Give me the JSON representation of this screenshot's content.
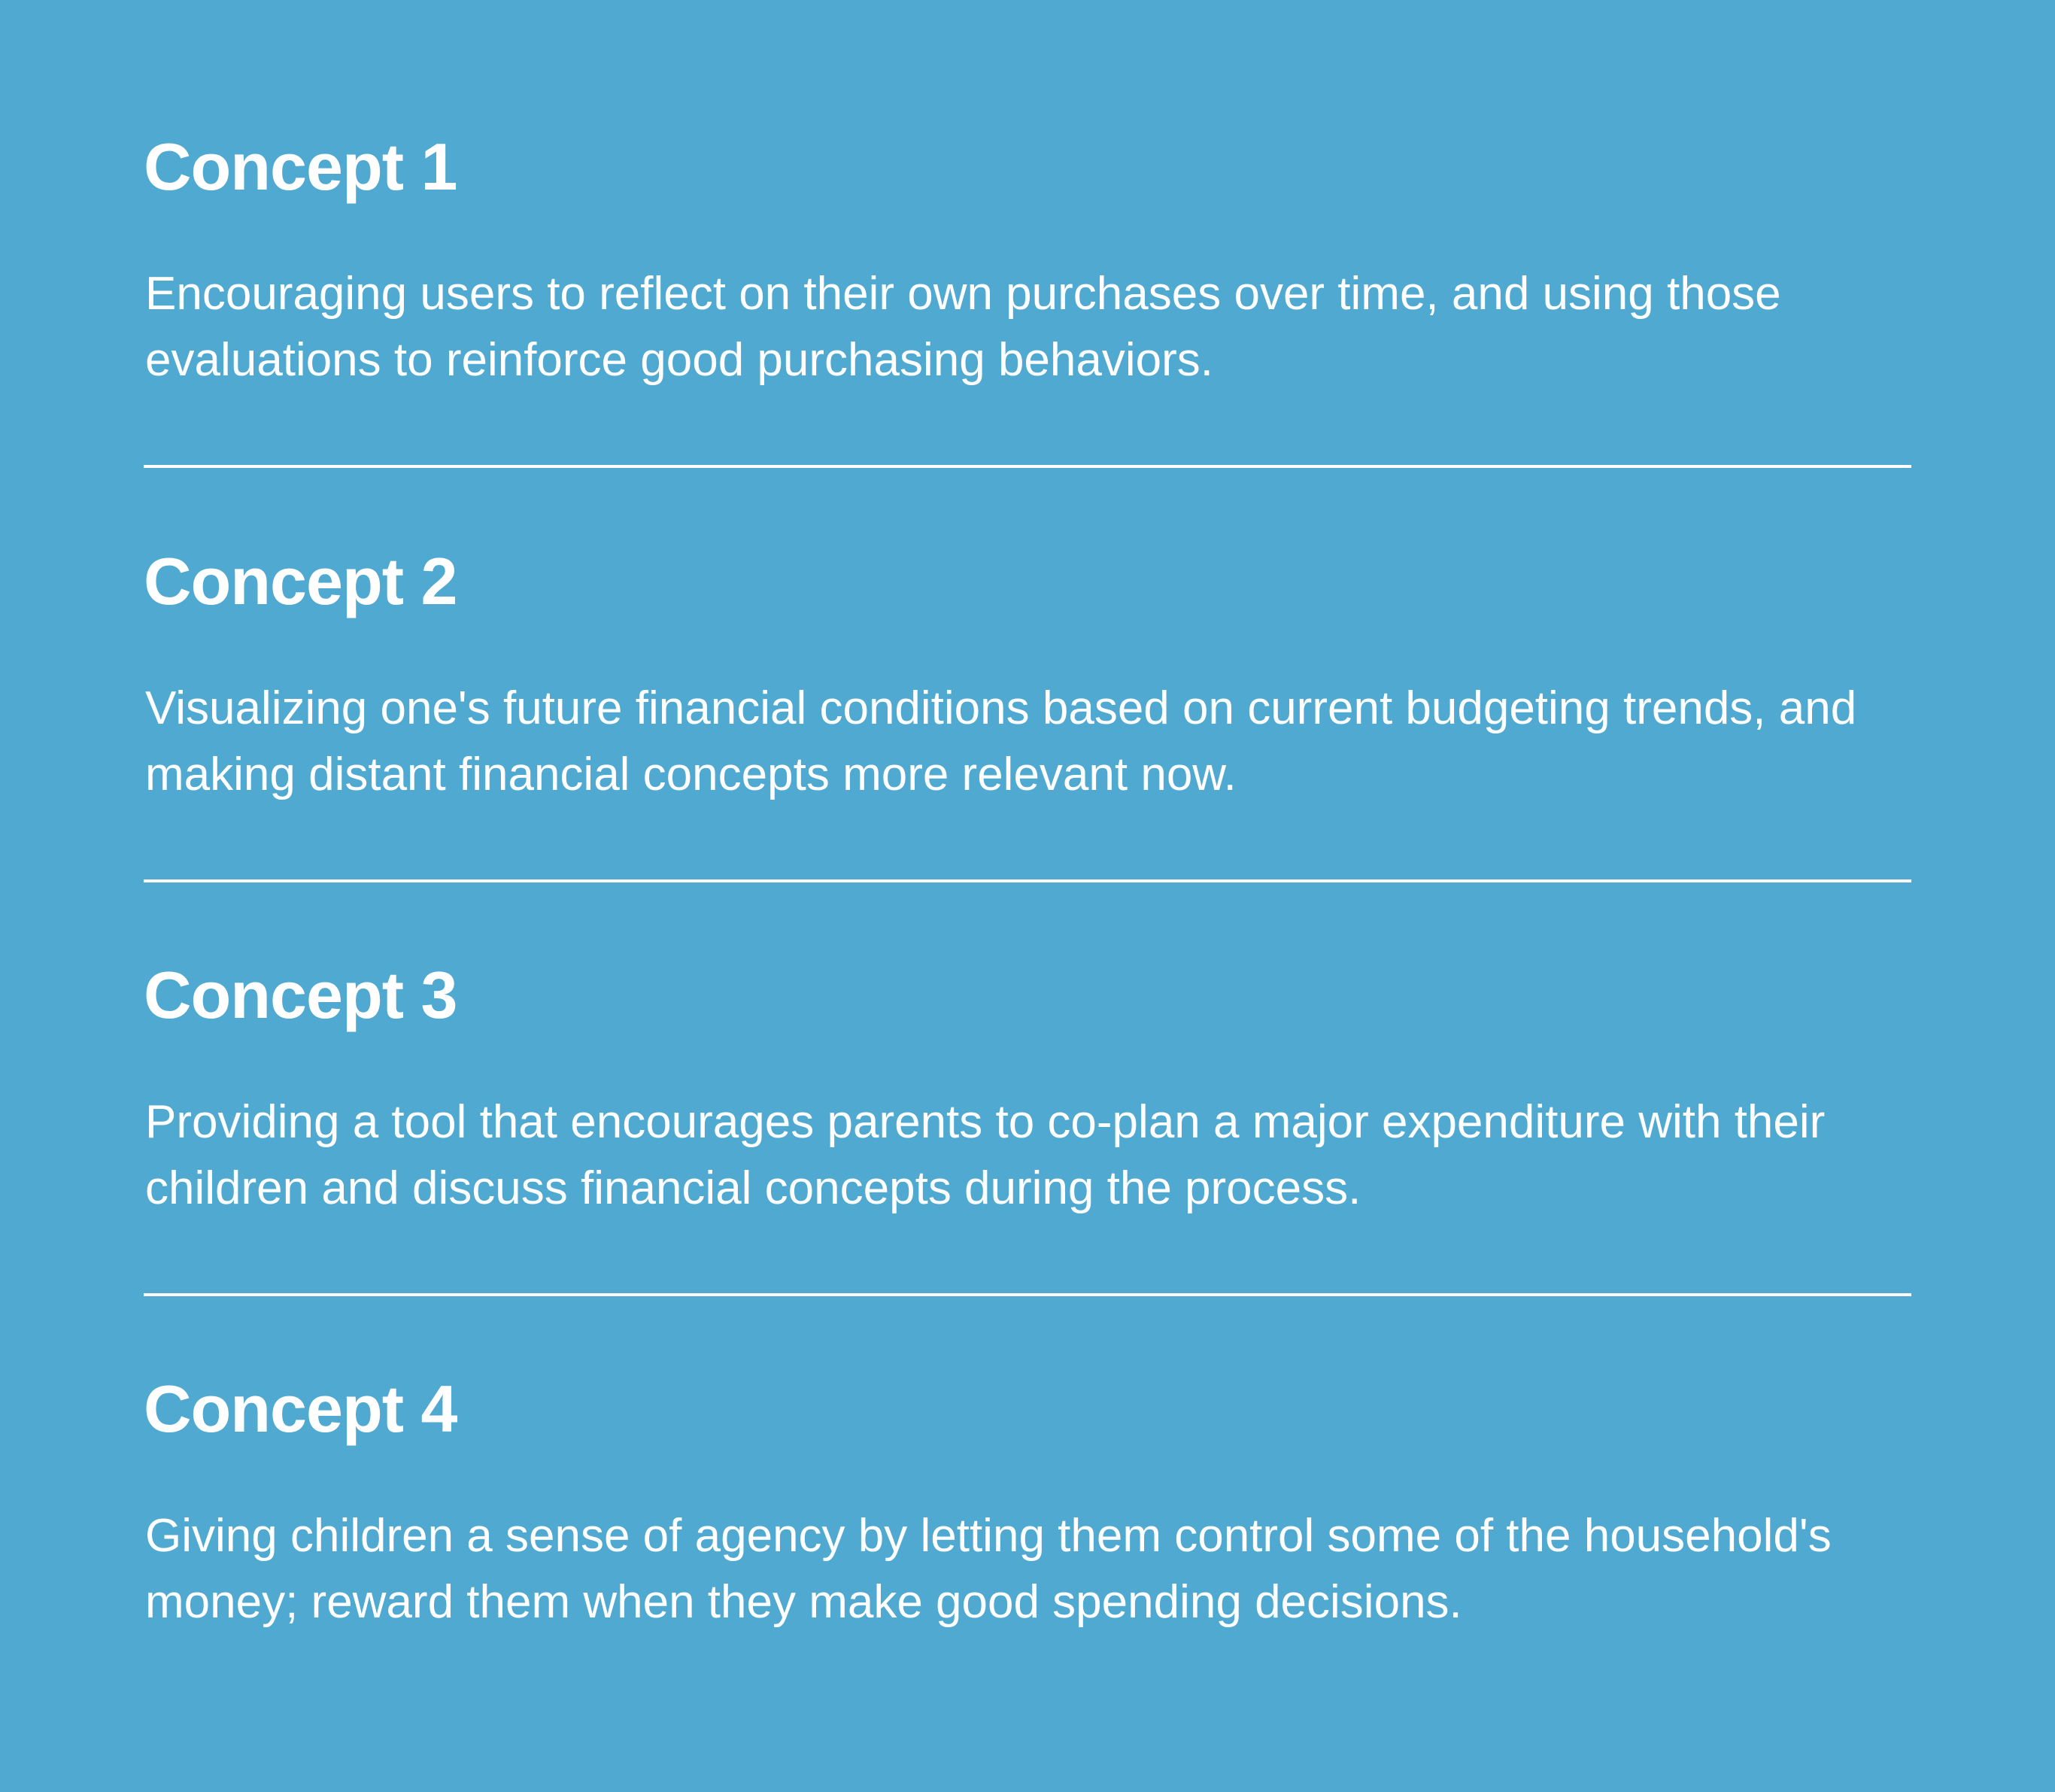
{
  "concepts": [
    {
      "title": "Concept 1",
      "description": "Encouraging users to reflect on their own purchases over time, and using those evaluations to reinforce good purchasing behaviors."
    },
    {
      "title": "Concept 2",
      "description": "Visualizing one's future financial conditions based on current budgeting trends, and making distant financial concepts more relevant now."
    },
    {
      "title": "Concept 3",
      "description": "Providing a tool that encourages parents to co-plan a major expenditure with their children and discuss financial concepts during the process."
    },
    {
      "title": "Concept 4",
      "description": "Giving children a sense of agency by letting them control some of the household's money; reward them when they make good spending decisions."
    }
  ],
  "colors": {
    "background": "#4fa9d0",
    "text": "#ffffff",
    "divider": "#ffffff"
  }
}
